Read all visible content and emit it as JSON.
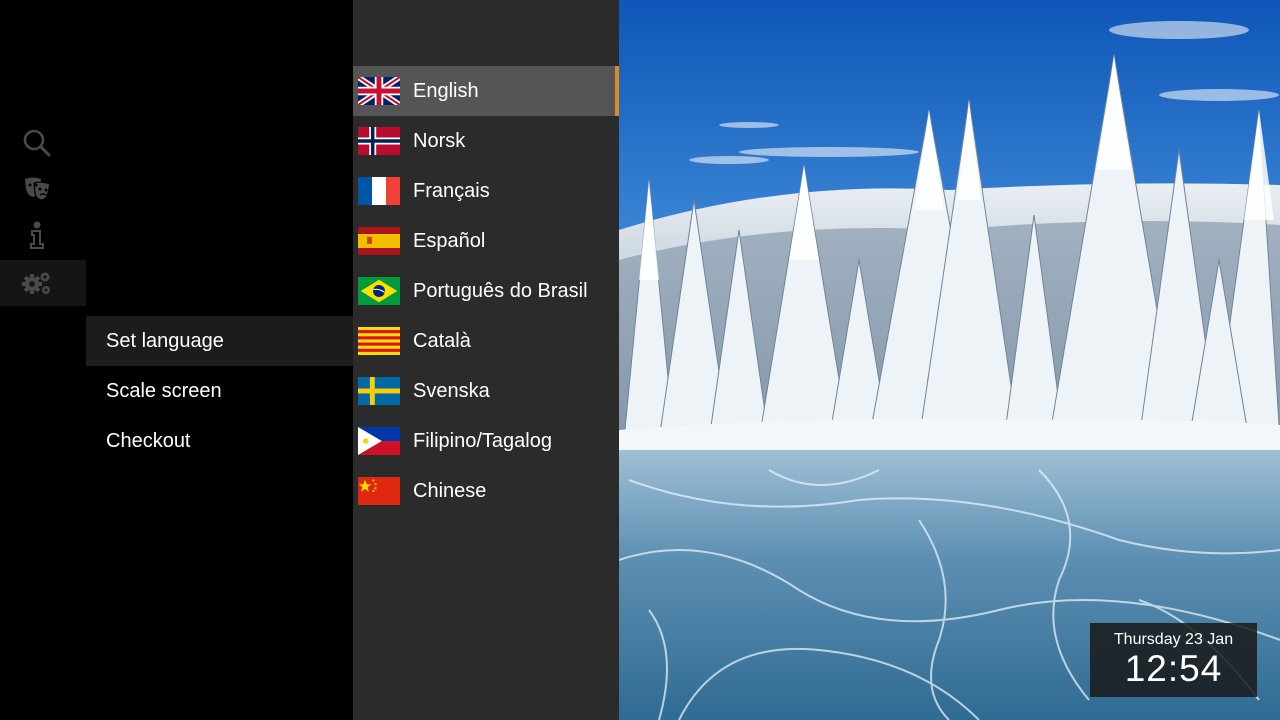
{
  "rail": {
    "items": [
      {
        "icon": "search-icon",
        "active": false
      },
      {
        "icon": "theater-masks-icon",
        "active": false
      },
      {
        "icon": "info-icon",
        "active": false
      },
      {
        "icon": "settings-gears-icon",
        "active": true
      }
    ]
  },
  "submenu": {
    "items": [
      {
        "label": "Set language",
        "active": true
      },
      {
        "label": "Scale screen",
        "active": false
      },
      {
        "label": "Checkout",
        "active": false
      }
    ]
  },
  "languages": {
    "selected": "English",
    "items": [
      {
        "label": "English",
        "flag": "uk-flag"
      },
      {
        "label": "Norsk",
        "flag": "norway-flag"
      },
      {
        "label": "Français",
        "flag": "france-flag"
      },
      {
        "label": "Español",
        "flag": "spain-flag"
      },
      {
        "label": "Português do Brasil",
        "flag": "brazil-flag"
      },
      {
        "label": "Català",
        "flag": "catalonia-flag"
      },
      {
        "label": "Svenska",
        "flag": "sweden-flag"
      },
      {
        "label": "Filipino/Tagalog",
        "flag": "philippines-flag"
      },
      {
        "label": "Chinese",
        "flag": "china-flag"
      }
    ]
  },
  "clock": {
    "date": "Thursday 23 Jan",
    "time": "12:54"
  },
  "colors": {
    "accent": "#e08a1c",
    "panel": "#2b2b2b",
    "selected_row": "#555555"
  }
}
